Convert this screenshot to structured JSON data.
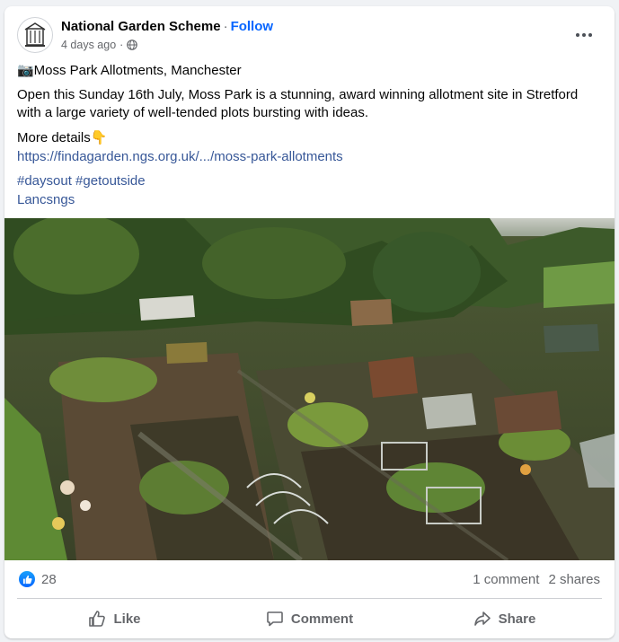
{
  "post": {
    "page_name": "National Garden Scheme",
    "separator": "·",
    "follow_label": "Follow",
    "timestamp": "4 days ago",
    "separator_dot": "·",
    "title_line": "📷Moss Park Allotments, Manchester",
    "description": "Open this Sunday 16th July, Moss Park is a stunning, award winning allotment site in Stretford with a large variety of well-tended plots bursting with ideas.",
    "more_details": "More details👇",
    "link": "https://findagarden.ngs.org.uk/.../moss-park-allotments",
    "hashtags": "#daysout #getoutside",
    "tag_line": "Lancsngs"
  },
  "stats": {
    "reaction_count": "28",
    "comments": "1 comment",
    "shares": "2 shares"
  },
  "actions": {
    "like": "Like",
    "comment": "Comment",
    "share": "Share"
  },
  "colors": {
    "link": "#385898",
    "follow": "#0866ff",
    "muted": "#65676b"
  }
}
